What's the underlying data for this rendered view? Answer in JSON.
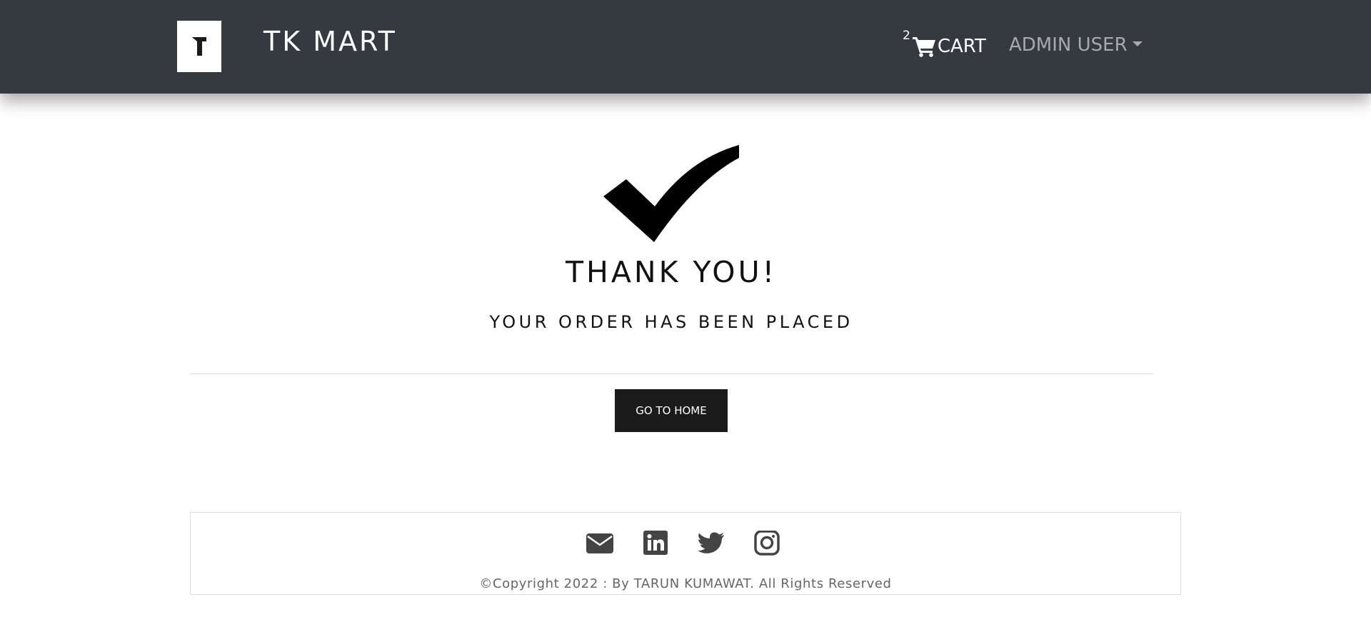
{
  "navbar": {
    "brand": "TK MART",
    "cart_count": "2",
    "cart_label": "CART",
    "user_label": "ADMIN USER"
  },
  "main": {
    "title": "THANK YOU!",
    "subtitle": "YOUR ORDER HAS BEEN PLACED",
    "home_button": "GO TO HOME"
  },
  "footer": {
    "icons": [
      "envelope-icon",
      "linkedin-icon",
      "twitter-icon",
      "instagram-icon"
    ],
    "copyright": "©Copyright 2022 : By TARUN KUMAWAT. All Rights Reserved"
  },
  "colors": {
    "navbar_bg": "#343a40",
    "button_bg": "#1b1b1b",
    "footer_icon": "#444444"
  }
}
